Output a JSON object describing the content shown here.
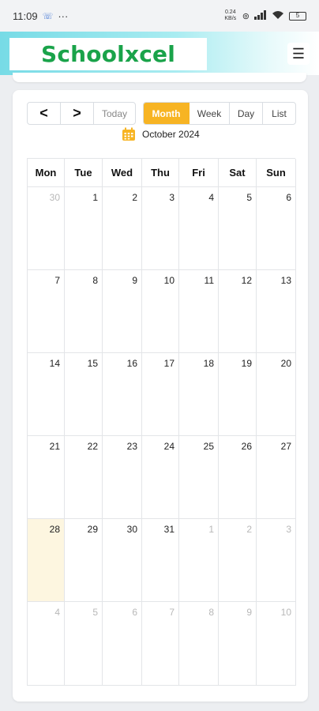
{
  "status_bar": {
    "time": "11:09",
    "speed": "0.24 KB/s",
    "battery": "5"
  },
  "header": {
    "logo_text": "Schoolxcel",
    "menu_icon": "hamburger-menu-icon"
  },
  "calendar": {
    "nav": {
      "prev": "<",
      "next": ">",
      "today": "Today"
    },
    "views": [
      "Month",
      "Week",
      "Day",
      "List"
    ],
    "active_view": "Month",
    "title": "October 2024",
    "weekdays": [
      "Mon",
      "Tue",
      "Wed",
      "Thu",
      "Fri",
      "Sat",
      "Sun"
    ],
    "weeks": [
      [
        {
          "d": "30",
          "o": true
        },
        {
          "d": "1"
        },
        {
          "d": "2"
        },
        {
          "d": "3"
        },
        {
          "d": "4"
        },
        {
          "d": "5"
        },
        {
          "d": "6"
        }
      ],
      [
        {
          "d": "7"
        },
        {
          "d": "8"
        },
        {
          "d": "9"
        },
        {
          "d": "10"
        },
        {
          "d": "11"
        },
        {
          "d": "12"
        },
        {
          "d": "13"
        }
      ],
      [
        {
          "d": "14"
        },
        {
          "d": "15"
        },
        {
          "d": "16"
        },
        {
          "d": "17"
        },
        {
          "d": "18"
        },
        {
          "d": "19"
        },
        {
          "d": "20"
        }
      ],
      [
        {
          "d": "21"
        },
        {
          "d": "22"
        },
        {
          "d": "23"
        },
        {
          "d": "24"
        },
        {
          "d": "25"
        },
        {
          "d": "26"
        },
        {
          "d": "27"
        }
      ],
      [
        {
          "d": "28",
          "today": true
        },
        {
          "d": "29"
        },
        {
          "d": "30"
        },
        {
          "d": "31"
        },
        {
          "d": "1",
          "o": true
        },
        {
          "d": "2",
          "o": true
        },
        {
          "d": "3",
          "o": true
        }
      ],
      [
        {
          "d": "4",
          "o": true
        },
        {
          "d": "5",
          "o": true
        },
        {
          "d": "6",
          "o": true
        },
        {
          "d": "7",
          "o": true
        },
        {
          "d": "8",
          "o": true
        },
        {
          "d": "9",
          "o": true
        },
        {
          "d": "10",
          "o": true
        }
      ]
    ]
  },
  "colors": {
    "accent": "#f7b423",
    "logo": "#1aa34a",
    "today_bg": "#fdf6e0"
  }
}
